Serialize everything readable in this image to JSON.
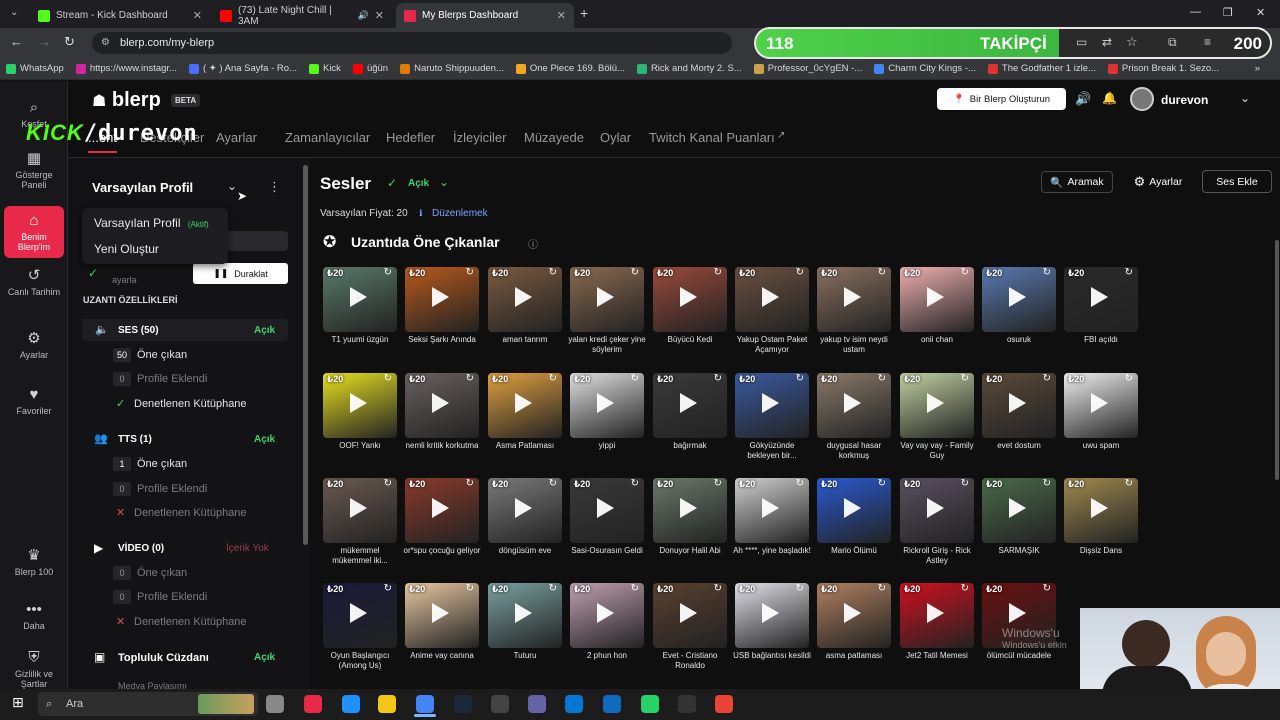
{
  "browser": {
    "tabs": [
      {
        "title": "Stream - Kick Dashboard",
        "color": "#53fc18"
      },
      {
        "title": "(73) Late Night Chill | 3AM",
        "color": "#ff0000"
      },
      {
        "title": "My Blerps Dashboard",
        "color": "#e8294a"
      }
    ],
    "url": "blerp.com/my-blerp",
    "bookmarks": [
      {
        "label": "WhatsApp",
        "color": "#25d366"
      },
      {
        "label": "https://www.instagr...",
        "color": "#d6249f"
      },
      {
        "label": "( ✦ ) Ana Sayfa - Ro...",
        "color": "#4a6cff"
      },
      {
        "label": "Kick",
        "color": "#53fc18"
      },
      {
        "label": "üğün",
        "color": "#ff0000"
      },
      {
        "label": "Naruto Shippuuden...",
        "color": "#e07b00"
      },
      {
        "label": "One Piece 169. Bölü...",
        "color": "#f5a623"
      },
      {
        "label": "Rick and Morty 2. S...",
        "color": "#2bb673"
      },
      {
        "label": "Professor_0cYgEN -...",
        "color": "#c8a24a"
      },
      {
        "label": "Charm City Kings -...",
        "color": "#4285f4"
      },
      {
        "label": "The Godfather 1 izle...",
        "color": "#d33"
      },
      {
        "label": "Prison Break 1. Sezo...",
        "color": "#d33"
      }
    ]
  },
  "overlay": {
    "follower_count": "118",
    "follower_label": "TAKİPÇİ",
    "follower_goal": "200",
    "follower_progress": 0.59,
    "kick_k": "KICK",
    "kick_name": "/durevon"
  },
  "app": {
    "logo": "blerp",
    "beta": "BETA",
    "create_button": "Bir Blerp Oluşturun",
    "username": "durevon",
    "leftnav": [
      {
        "label": "Keşfet",
        "icon": "compass-icon"
      },
      {
        "label": "Gösterge Paneli",
        "icon": "grid-icon"
      },
      {
        "label": "Benim Blerp'im",
        "icon": "home-icon"
      },
      {
        "label": "Canlı Tarihim",
        "icon": "history-icon"
      },
      {
        "label": "Ayarlar",
        "icon": "gear-icon"
      },
      {
        "label": "Favoriler",
        "icon": "heart-icon"
      },
      {
        "label": "Blerp 100",
        "icon": "crown-icon"
      },
      {
        "label": "Daha",
        "icon": "more-icon"
      },
      {
        "label": "Gizlilik ve Şartlar",
        "icon": "shield-icon"
      }
    ],
    "mainnav": [
      "Zamanlayıcılar",
      "Hedefler",
      "İzleyiciler",
      "Müzayede",
      "Oylar",
      "Twitch Kanal Puanları"
    ],
    "mainnav_partial": [
      "...ent",
      "Destekçiler",
      "Ayarlar"
    ]
  },
  "sidebar": {
    "profile_select": "Varsayılan Profil",
    "dropdown": {
      "item1": "Varsayılan Profil",
      "item1_badge": "(Aktif)",
      "item2": "Yeni Oluştur"
    },
    "partial_label": "ayarla",
    "pause_button": "Duraklat",
    "section_title": "UZANTI ÖZELLİKLERİ",
    "ses": {
      "label": "SES (50)",
      "status": "Açık",
      "featured_count": "50",
      "featured": "Öne çıkan",
      "added_count": "0",
      "added": "Profile Eklendi",
      "library": "Denetlenen Kütüphane"
    },
    "tts": {
      "label": "TTS (1)",
      "status": "Açık",
      "featured_count": "1",
      "featured": "Öne çıkan",
      "added_count": "0",
      "added": "Profile Eklendi",
      "library": "Denetlenen Kütüphane"
    },
    "video": {
      "label": "VİDEO (0)",
      "status": "İçerik Yok",
      "featured_count": "0",
      "featured": "Öne çıkan",
      "added_count": "0",
      "added": "Profile Eklendi",
      "library": "Denetlenen Kütüphane"
    },
    "wallet": {
      "label": "Topluluk Cüzdanı",
      "status": "Açık"
    },
    "media_partial": "Medya Paylaşımı"
  },
  "main": {
    "title": "Sesler",
    "status": "Açık",
    "search_btn": "Aramak",
    "settings_btn": "Ayarlar",
    "add_btn": "Ses Ekle",
    "price_label": "Varsayılan Fiyat: 20",
    "edit_link": "Düzenlemek",
    "featured_title": "Uzantıda Öne Çıkanlar",
    "sounds": [
      {
        "label": "T1 yuumi üzgün",
        "price": "20",
        "color": "#5a7a6a"
      },
      {
        "label": "Seksi Şarkı Anında",
        "price": "20",
        "color": "#b85a1c"
      },
      {
        "label": "aman tanrım",
        "price": "20",
        "color": "#7a5a40"
      },
      {
        "label": "yalan kredi çeker yine söylerim",
        "price": "20",
        "color": "#8a6a50"
      },
      {
        "label": "Büyücü Kedi",
        "price": "20",
        "color": "#9a4a3a"
      },
      {
        "label": "Yakup Ostam Paket Açamıyor",
        "price": "20",
        "color": "#6a5040"
      },
      {
        "label": "yakup tv isim neydi ustam",
        "price": "20",
        "color": "#8a7060"
      },
      {
        "label": "onii chan",
        "price": "20",
        "color": "#f0b0b0"
      },
      {
        "label": "osuruk",
        "price": "20",
        "color": "#5a7ab0"
      },
      {
        "label": "FBI açıldı",
        "price": "20",
        "color": "#2a2a2a"
      },
      {
        "label": "OOF! Yankı",
        "price": "20",
        "color": "#e8e020"
      },
      {
        "label": "nemli kritik korkutma",
        "price": "20",
        "color": "#6a6060"
      },
      {
        "label": "Asma Patlaması",
        "price": "20",
        "color": "#e0a040"
      },
      {
        "label": "yippi",
        "price": "20",
        "color": "#e0e0e0"
      },
      {
        "label": "bağırmak",
        "price": "20",
        "color": "#3a3a3a"
      },
      {
        "label": "Gökyüzünde bekleyen bir...",
        "price": "20",
        "color": "#3a5aa0"
      },
      {
        "label": "duygusal hasar korkmuş",
        "price": "20",
        "color": "#8a7a6a"
      },
      {
        "label": "Vay vay vay - Family Guy",
        "price": "20",
        "color": "#c0d0a0"
      },
      {
        "label": "evet dostum",
        "price": "20",
        "color": "#5a4a3a"
      },
      {
        "label": "uwu spam",
        "price": "20",
        "color": "#f0f0f0"
      },
      {
        "label": "mükemmel mükemmel iki...",
        "price": "20",
        "color": "#6a5a50"
      },
      {
        "label": "or*spu çocuğu geliyor",
        "price": "20",
        "color": "#8a3a2a"
      },
      {
        "label": "döngüsüm eve",
        "price": "20",
        "color": "#7a7a7a"
      },
      {
        "label": "Sasi-Osurasın Geldi",
        "price": "20",
        "color": "#3a3a3a"
      },
      {
        "label": "Donuyor Halil Abi",
        "price": "20",
        "color": "#6a7a6a"
      },
      {
        "label": "Ah ****, yine başladık!",
        "price": "20",
        "color": "#d0d0d0"
      },
      {
        "label": "Mario Ölümü",
        "price": "20",
        "color": "#2a5ad0"
      },
      {
        "label": "Rickroll Giriş - Rick Astley",
        "price": "20",
        "color": "#5a5060"
      },
      {
        "label": "SARMAŞIK",
        "price": "20",
        "color": "#4a6a4a"
      },
      {
        "label": "Dişsiz Dans",
        "price": "20",
        "color": "#a08a50"
      },
      {
        "label": "Oyun Başlangıcı (Among Us)",
        "price": "20",
        "color": "#1a1a3a"
      },
      {
        "label": "Anime vay canına",
        "price": "20",
        "color": "#e8c8a0"
      },
      {
        "label": "Tuturu",
        "price": "20",
        "color": "#7aa0a0"
      },
      {
        "label": "2 phun hon",
        "price": "20",
        "color": "#c0a0b0"
      },
      {
        "label": "Evet - Cristiano Ronaldo",
        "price": "20",
        "color": "#5a4030"
      },
      {
        "label": "USB bağlantısı kesildi",
        "price": "20",
        "color": "#e0e0e8"
      },
      {
        "label": "asma patlaması",
        "price": "20",
        "color": "#b08060"
      },
      {
        "label": "Jet2 Tatil Memesi",
        "price": "20",
        "color": "#d01020"
      },
      {
        "label": "ölümcül mücadele",
        "price": "20",
        "color": "#6a1010"
      }
    ]
  },
  "system": {
    "watermark_line1": "Windows'u",
    "watermark_line2": "Windows'u etkin",
    "taskbar_search": "Ara"
  }
}
